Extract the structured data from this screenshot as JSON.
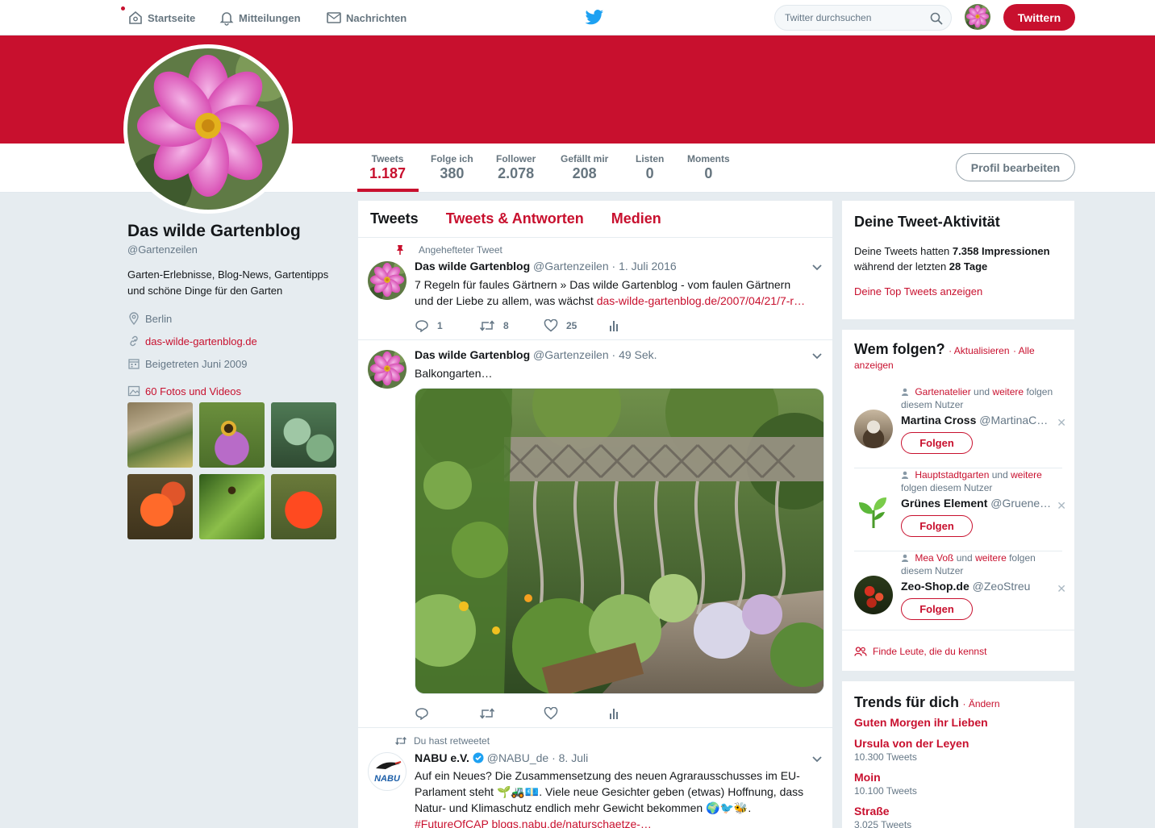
{
  "nav": {
    "home": "Startseite",
    "notifications": "Mitteilungen",
    "messages": "Nachrichten",
    "search_placeholder": "Twitter durchsuchen",
    "tweet_button": "Twittern"
  },
  "colors": {
    "accent": "#c8102e",
    "background": "#e6ecf0"
  },
  "profile": {
    "name": "Das wilde Gartenblog",
    "handle": "@Gartenzeilen",
    "bio": "Garten-Erlebnisse, Blog-News, Gartentipps und schöne Dinge für den Garten",
    "location": "Berlin",
    "website": "das-wilde-gartenblog.de",
    "joined": "Beigetreten Juni 2009",
    "photos_link": "60 Fotos und Videos",
    "edit_button": "Profil bearbeiten"
  },
  "stats": [
    {
      "label": "Tweets",
      "value": "1.187"
    },
    {
      "label": "Folge ich",
      "value": "380"
    },
    {
      "label": "Follower",
      "value": "2.078"
    },
    {
      "label": "Gefällt mir",
      "value": "208"
    },
    {
      "label": "Listen",
      "value": "0"
    },
    {
      "label": "Moments",
      "value": "0"
    }
  ],
  "tabs": [
    "Tweets",
    "Tweets & Antworten",
    "Medien"
  ],
  "tweets": [
    {
      "context": "Angehefteter Tweet",
      "name": "Das wilde Gartenblog",
      "meta": "@Gartenzeilen · 1. Juli 2016",
      "text": "7 Regeln für faules Gärtnern » Das wilde Gartenblog - vom faulen Gärtnern und der Liebe zu allem, was wächst",
      "link": "das-wilde-gartenblog.de/2007/04/21/7-r…",
      "replies": "1",
      "retweets": "8",
      "likes": "25"
    },
    {
      "name": "Das wilde Gartenblog",
      "meta": "@Gartenzeilen · 49 Sek.",
      "text": "Balkongarten…"
    },
    {
      "context": "Du hast retweetet",
      "name": "NABU e.V.",
      "meta": "@NABU_de · 8. Juli",
      "text": "Auf ein Neues? Die Zusammensetzung des neuen Agrarausschusses im EU-Parlament steht 🌱🚜💶. Viele neue Gesichter geben (etwas) Hoffnung, dass Natur- und Klimaschutz endlich mehr Gewicht bekommen 🌍🐦🐝.",
      "link": "#FutureOfCAP blogs.nabu.de/naturschaetze-…",
      "avatar_text": "NABU"
    }
  ],
  "activity": {
    "title": "Deine Tweet-Aktivität",
    "text_1": "Deine Tweets hatten ",
    "impressions": "7.358 Impressionen",
    "text_2": " während der letzten ",
    "days": "28 Tage",
    "link": "Deine Top Tweets anzeigen"
  },
  "who_to_follow": {
    "title": "Wem folgen?",
    "refresh": "· Aktualisieren",
    "show_all": "· Alle anzeigen",
    "follow_label": "Folgen",
    "find_people": "Finde Leute, die du kennst",
    "suggestions": [
      {
        "ctx_user": "Gartenatelier",
        "ctx_and": " und ",
        "ctx_more": "weitere",
        "ctx_rest": " folgen diesem Nutzer",
        "name": "Martina Cross",
        "handle": "@MartinaC…"
      },
      {
        "ctx_user": "Hauptstadtgarten",
        "ctx_and": " und ",
        "ctx_more": "weitere",
        "ctx_rest": " folgen diesem Nutzer",
        "name": "Grünes Element",
        "handle": "@Gruene…"
      },
      {
        "ctx_user": "Mea Voß",
        "ctx_and": " und ",
        "ctx_more": "weitere",
        "ctx_rest": " folgen diesem Nutzer",
        "name": "Zeo-Shop.de",
        "handle": "@ZeoStreu"
      }
    ]
  },
  "trends": {
    "title": "Trends für dich",
    "change": "· Ändern",
    "items": [
      {
        "name": "Guten Morgen ihr Lieben",
        "count": ""
      },
      {
        "name": "Ursula von der Leyen",
        "count": "10.300 Tweets"
      },
      {
        "name": "Moin",
        "count": "10.100 Tweets"
      },
      {
        "name": "Straße",
        "count": "3.025 Tweets"
      }
    ]
  }
}
